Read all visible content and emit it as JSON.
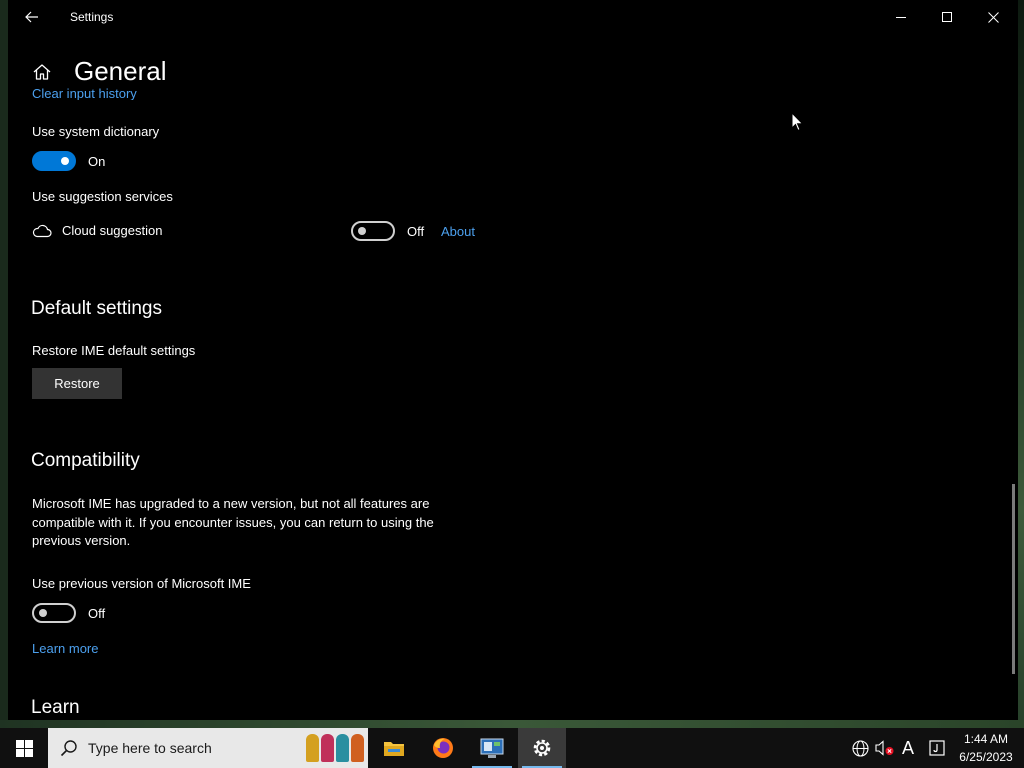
{
  "window": {
    "title": "Settings",
    "minimize_label": "Minimize",
    "maximize_label": "Maximize",
    "close_label": "Close"
  },
  "header": {
    "title": "General"
  },
  "clipped_link": "Clear input history",
  "dictionary": {
    "label": "Use system dictionary",
    "state": "On"
  },
  "suggestion": {
    "label": "Use suggestion services",
    "cloud_label": "Cloud suggestion",
    "state": "Off",
    "about_link": "About"
  },
  "default_settings": {
    "title": "Default settings",
    "label": "Restore IME default settings",
    "button": "Restore"
  },
  "compatibility": {
    "title": "Compatibility",
    "description": "Microsoft IME has upgraded to a new version, but not all features are compatible with it. If you encounter issues, you can return to using the previous version.",
    "toggle_label": "Use previous version of Microsoft IME",
    "state": "Off",
    "learn_more": "Learn more"
  },
  "learn": {
    "title": "Learn"
  },
  "taskbar": {
    "search_placeholder": "Type here to search",
    "apps": [
      "file-explorer-icon",
      "firefox-icon",
      "control-panel-icon",
      "settings-icon"
    ],
    "tray_ime_label": "A",
    "clock_time": "1:44 AM",
    "clock_date": "6/25/2023"
  },
  "colors": {
    "accent": "#0078d7",
    "link": "#4ca0ee",
    "background": "#000000"
  }
}
